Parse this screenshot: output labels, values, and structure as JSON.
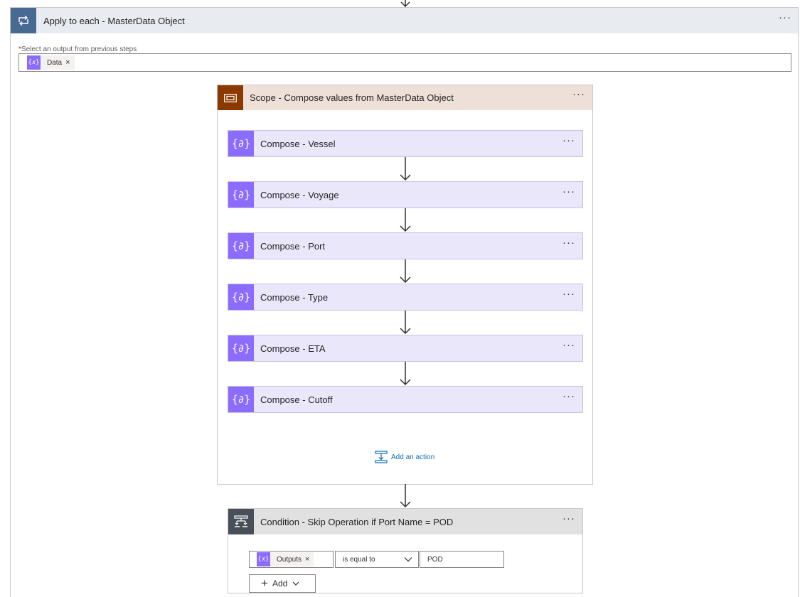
{
  "apply_to_each": {
    "title": "Apply to each - MasterData Object",
    "more": "···",
    "select_output": {
      "required_marker": "*",
      "label": "Select an output from previous steps",
      "token_icon": "{𝑥}",
      "token_label": "Data",
      "token_remove": "×"
    }
  },
  "scope": {
    "title": "Scope - Compose values from MasterData Object",
    "more": "···",
    "actions": [
      {
        "title": "Compose - Vessel",
        "icon": "{𝑥}",
        "more": "···"
      },
      {
        "title": "Compose - Voyage",
        "icon": "{𝑥}",
        "more": "···"
      },
      {
        "title": "Compose - Port",
        "icon": "{𝑥}",
        "more": "···"
      },
      {
        "title": "Compose - Type",
        "icon": "{𝑥}",
        "more": "···"
      },
      {
        "title": "Compose - ETA",
        "icon": "{𝑥}",
        "more": "···"
      },
      {
        "title": "Compose - Cutoff",
        "icon": "{𝑥}",
        "more": "···"
      }
    ],
    "add_action": "Add an action"
  },
  "condition": {
    "title": "Condition - Skip Operation if Port Name = POD",
    "more": "···",
    "left_token_icon": "{𝑥}",
    "left_token": "Outputs",
    "left_token_remove": "×",
    "operator": "is equal to",
    "value": "POD",
    "add_label": "Add"
  },
  "colors": {
    "loop_icon_bg": "#486991",
    "scope_icon_bg": "#8c3900",
    "compose_icon_bg": "#8c6cff",
    "compose_card_bg": "#ebe7fb",
    "condition_icon_bg": "#484f58",
    "link": "#0f6cbd"
  },
  "icons": {
    "loop": "loop-icon",
    "scope": "scope-icon",
    "compose": "compose-icon",
    "condition": "condition-icon",
    "add_action": "add-action-icon"
  }
}
